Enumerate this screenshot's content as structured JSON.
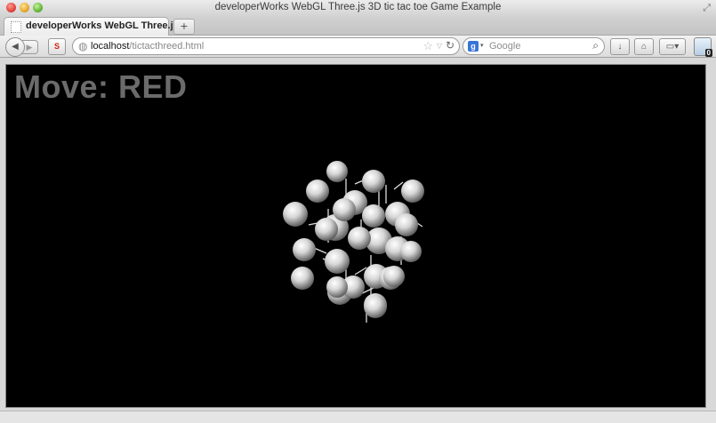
{
  "window": {
    "title": "developerWorks WebGL Three.js 3D tic tac toe Game Example"
  },
  "tabs": [
    {
      "label": "developerWorks WebGL Three.js..."
    }
  ],
  "toolbar": {
    "new_tab_glyph": "+",
    "back_glyph": "◀",
    "forward_glyph": "▶",
    "addon_label": "S",
    "url_host": "localhost",
    "url_path": "/tictacthreed.html",
    "bookmark_glyph": "☆",
    "reload_glyph": "↻",
    "search_engine": "g",
    "search_placeholder": "Google",
    "search_icon_glyph": "⌕",
    "download_glyph": "↓",
    "home_glyph": "⌂",
    "menu_glyph": "▭▾",
    "addon_badge_count": "0"
  },
  "game": {
    "status_text": "Move: RED",
    "status_color": "#6b6b6b",
    "background_color": "#000000",
    "piece_color": "#e6e6e6",
    "pieces_count": 27
  }
}
